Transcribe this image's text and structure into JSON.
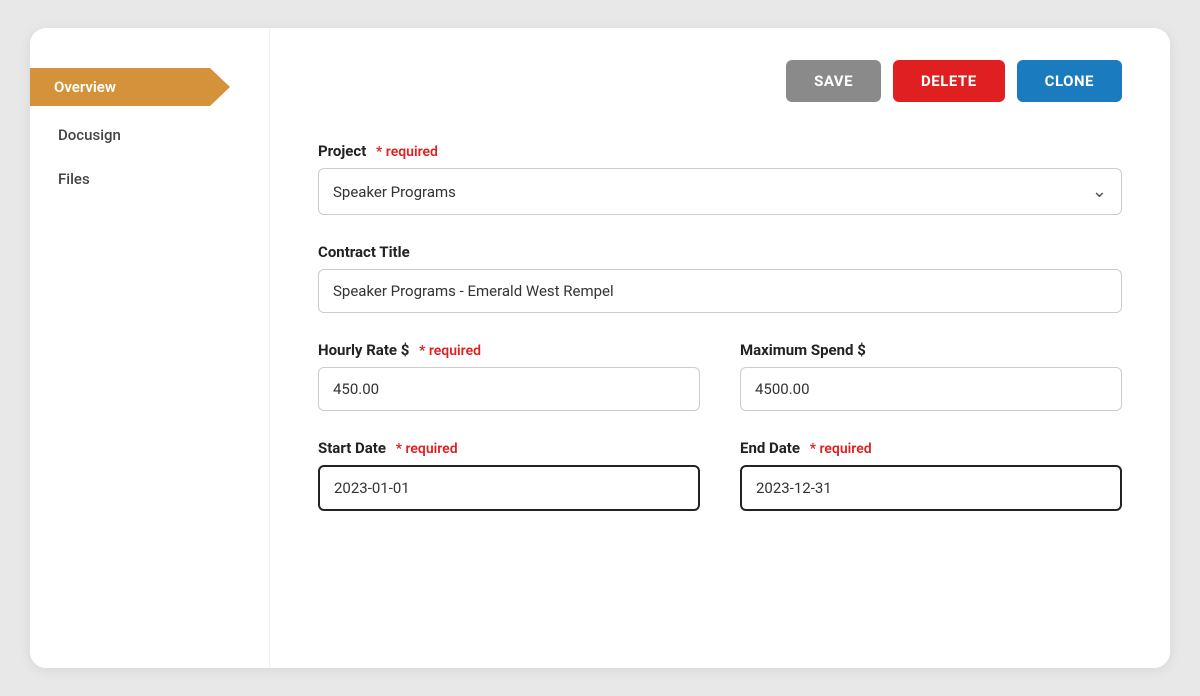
{
  "sidebar": {
    "items": [
      {
        "id": "overview",
        "label": "Overview",
        "active": true
      },
      {
        "id": "docusign",
        "label": "Docusign",
        "active": false
      },
      {
        "id": "files",
        "label": "Files",
        "active": false
      }
    ]
  },
  "toolbar": {
    "save_label": "SAVE",
    "delete_label": "DELETE",
    "clone_label": "CLONE"
  },
  "form": {
    "project_label": "Project",
    "project_required": "* required",
    "project_value": "Speaker Programs",
    "contract_title_label": "Contract Title",
    "contract_title_value": "Speaker Programs - Emerald West Rempel",
    "hourly_rate_label": "Hourly Rate $",
    "hourly_rate_required": "* required",
    "hourly_rate_value": "450.00",
    "max_spend_label": "Maximum Spend $",
    "max_spend_value": "4500.00",
    "start_date_label": "Start Date",
    "start_date_required": "* required",
    "start_date_value": "2023-01-01",
    "end_date_label": "End Date",
    "end_date_required": "* required",
    "end_date_value": "2023-12-31"
  },
  "colors": {
    "sidebar_active": "#d4923a",
    "btn_save": "#8a8a8a",
    "btn_delete": "#e02020",
    "btn_clone": "#1a7cbf",
    "required_color": "#e02020"
  }
}
